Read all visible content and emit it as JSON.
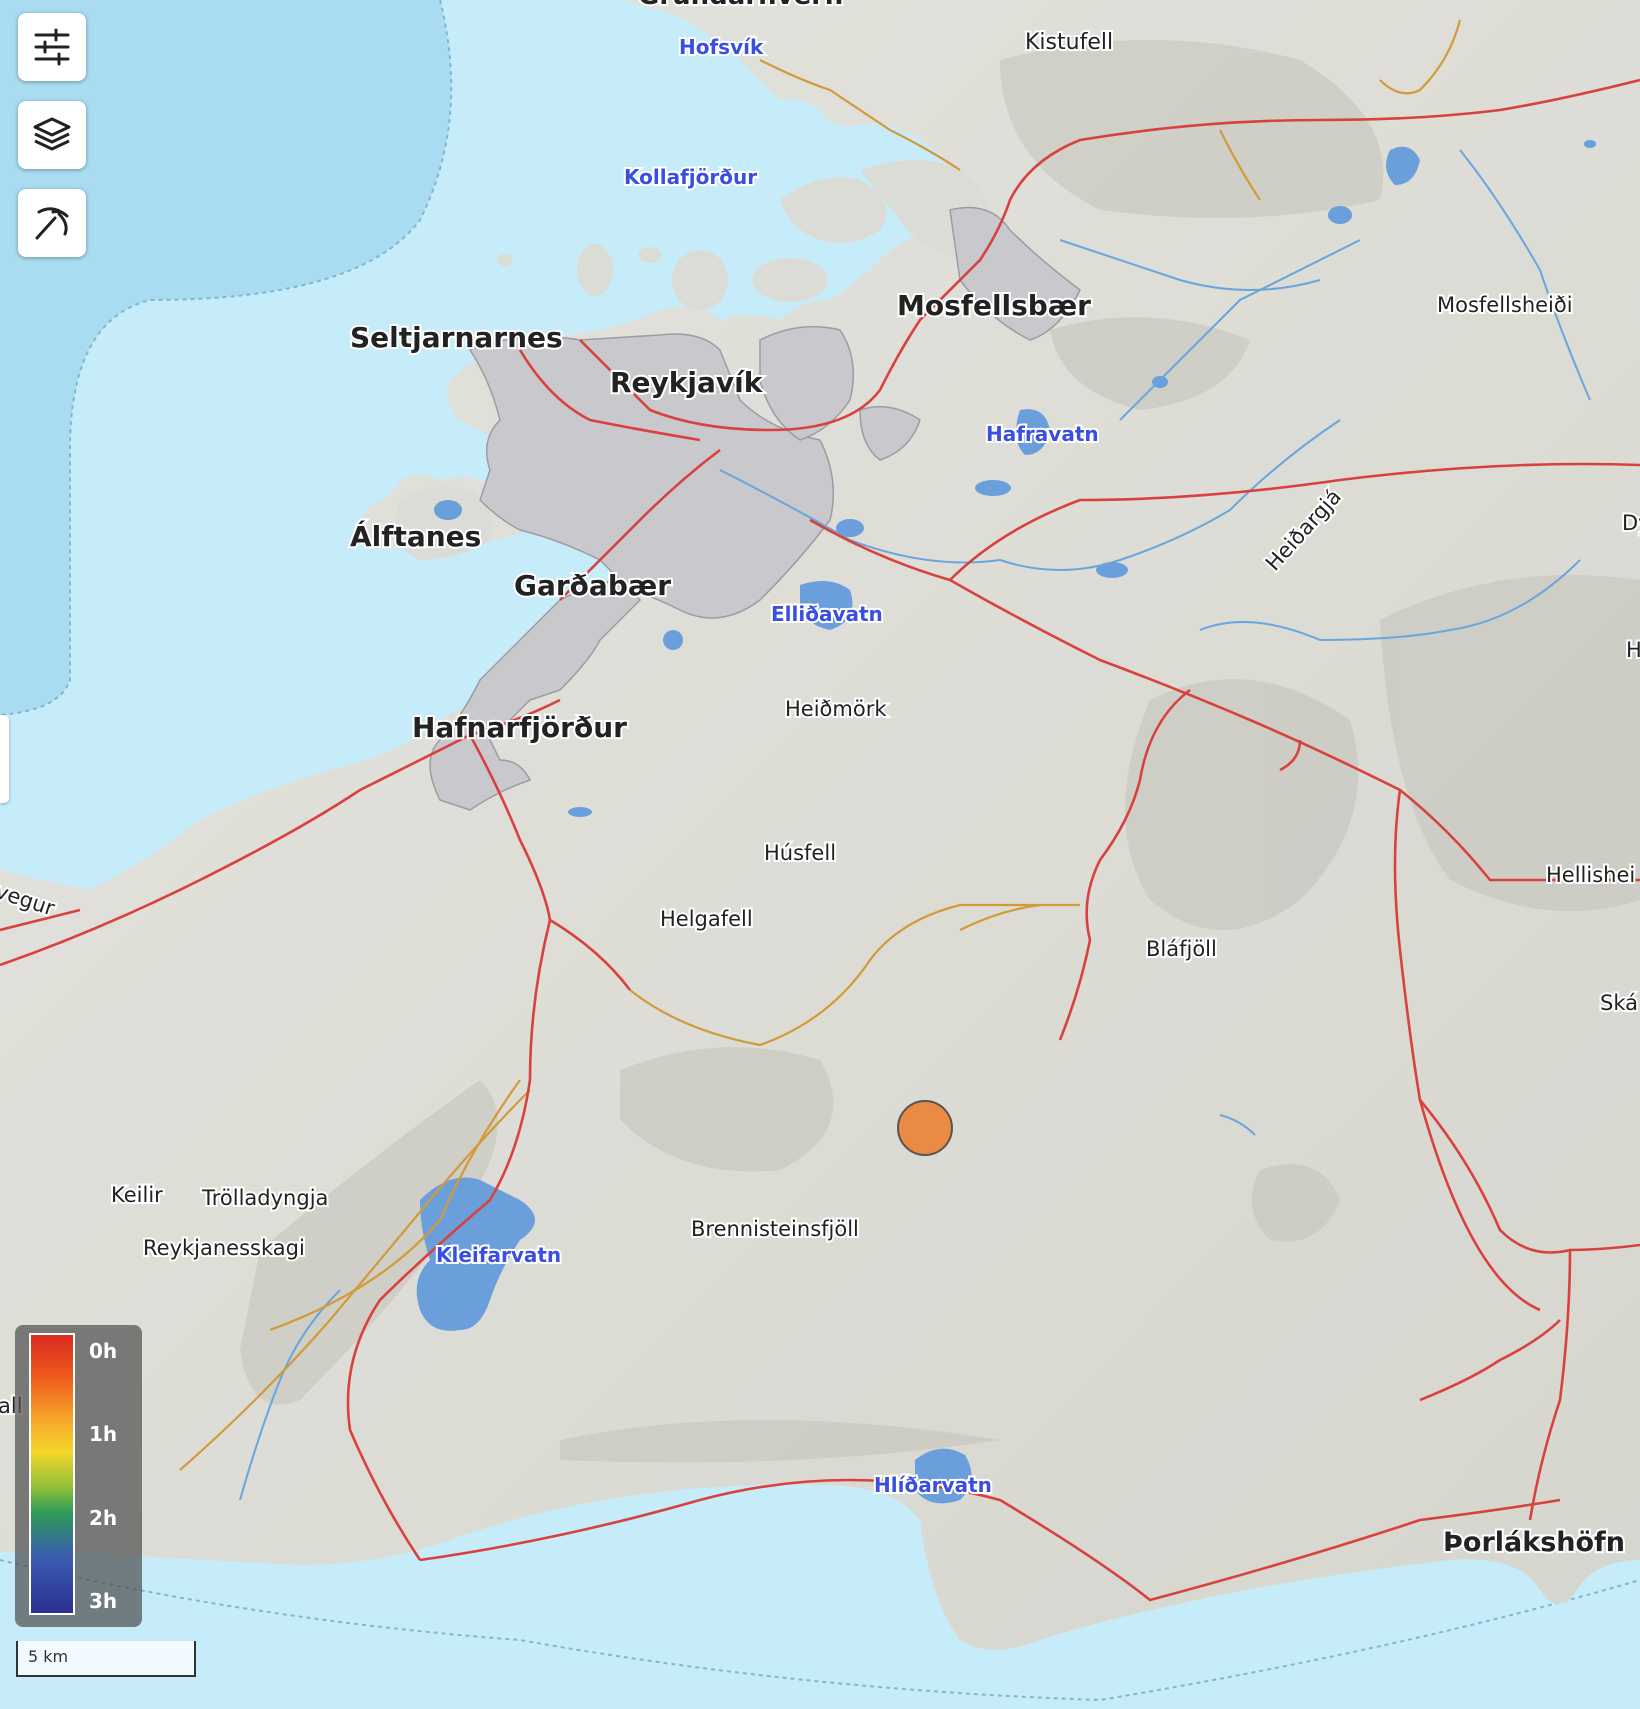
{
  "controls": {
    "filters_icon": "sliders-icon",
    "layers_icon": "layers-icon",
    "draw_icon": "pickaxe-icon"
  },
  "labels": {
    "grundarfjordur_cut": "Grundarhverfi",
    "hofsvik": "Hofsvík",
    "kistufell": "Kistufell",
    "kollafjordur": "Kollafjörður",
    "mosfellsbaer": "Mosfellsbær",
    "mosfellsheidi": "Mosfellsheiði",
    "seltjarnarnes": "Seltjarnarnes",
    "reykjavik": "Reykjavík",
    "hafravatn": "Hafravatn",
    "alftanes": "Álftanes",
    "gardabaer": "Garðabær",
    "ellidavatn": "Elliðavatn",
    "heidargja": "Heiðargjá",
    "dy_cut": "Dy",
    "h_cut": "H",
    "hafnarfjordur": "Hafnarfjörður",
    "heidmork": "Heiðmörk",
    "husfell": "Húsfell",
    "helgafell": "Helgafell",
    "blafjoll": "Bláfjöll",
    "hellisheidi_cut": "Hellishei",
    "ska_cut": "Ská",
    "vegur_cut": "vegur",
    "keilir": "Keilir",
    "trolladyngja": "Trölladyngja",
    "reykjanesskagi": "Reykjanesskagi",
    "kleifarvatn": "Kleifarvatn",
    "brennisteinsfjoll": "Brennisteinsfjöll",
    "hlidarvatn": "Hlíðarvatn",
    "thorlakshofn": "Þorlákshöfn",
    "all_cut": "all"
  },
  "legend": {
    "ticks": [
      "0h",
      "1h",
      "2h",
      "3h"
    ],
    "colors": [
      "#d92a1f",
      "#f7a52a",
      "#f4d62a",
      "#2c9b5a",
      "#2b2f92"
    ]
  },
  "scale": {
    "label": "5 km"
  },
  "marker": {
    "color": "#e98a45"
  },
  "colors": {
    "water": "#c6ecfa",
    "deep_water": "#a9dcf1",
    "land": "#dcdcd6",
    "urban": "#c9c8cc",
    "road": "#d9413f",
    "track": "#d39a3a",
    "river": "#6aa5dc",
    "lake": "#6b9fdc",
    "water_label": "#3a4fe0"
  }
}
